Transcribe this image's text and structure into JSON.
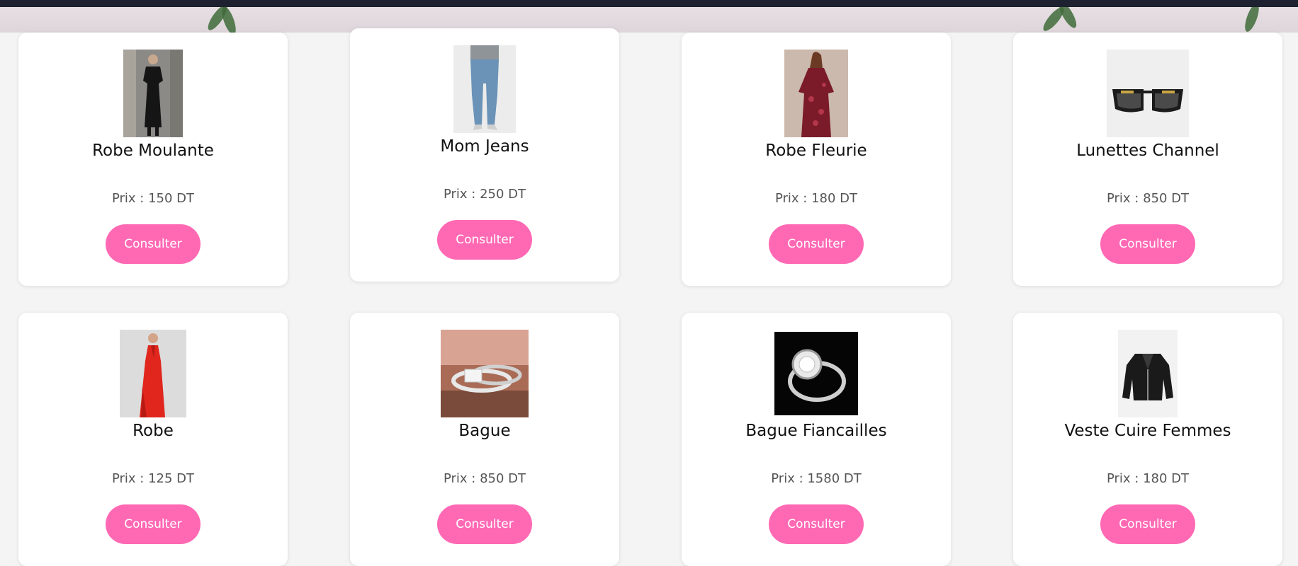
{
  "theme": {
    "accent": "#ff69b4",
    "card_bg": "#ffffff",
    "page_bg": "#f4f4f4"
  },
  "products": [
    {
      "name": "Robe Moulante",
      "price": "Prix : 150 DT",
      "button": "Consulter",
      "image": "black-dress-photo"
    },
    {
      "name": "Mom Jeans",
      "price": "Prix : 250 DT",
      "button": "Consulter",
      "image": "jeans-photo"
    },
    {
      "name": "Robe Fleurie",
      "price": "Prix : 180 DT",
      "button": "Consulter",
      "image": "floral-dress-photo"
    },
    {
      "name": "Lunettes Channel",
      "price": "Prix : 850 DT",
      "button": "Consulter",
      "image": "sunglasses-photo"
    },
    {
      "name": "Robe",
      "price": "Prix : 125 DT",
      "button": "Consulter",
      "image": "red-dress-photo"
    },
    {
      "name": "Bague",
      "price": "Prix : 850 DT",
      "button": "Consulter",
      "image": "ring-photo"
    },
    {
      "name": "Bague Fiancailles",
      "price": "Prix : 1580 DT",
      "button": "Consulter",
      "image": "engagement-ring-photo"
    },
    {
      "name": "Veste Cuire Femmes",
      "price": "Prix : 180 DT",
      "button": "Consulter",
      "image": "leather-jacket-photo"
    }
  ]
}
